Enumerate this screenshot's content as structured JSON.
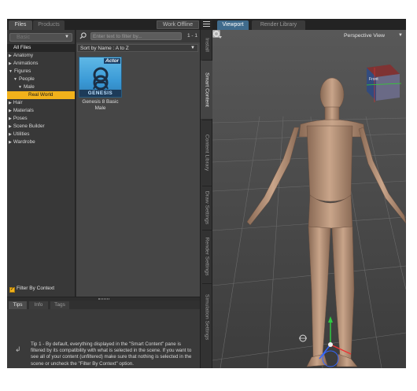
{
  "top_tabs": {
    "files": "Files",
    "products": "Products",
    "work_offline": "Work Offline"
  },
  "filter_dropdown": {
    "placeholder": "Basic"
  },
  "categories": [
    {
      "label": "All Files",
      "kind": "all"
    },
    {
      "label": "Anatomy",
      "kind": "collapsed"
    },
    {
      "label": "Animations",
      "kind": "collapsed"
    },
    {
      "label": "Figures",
      "kind": "expanded"
    },
    {
      "label": "People",
      "kind": "expanded-1"
    },
    {
      "label": "Male",
      "kind": "expanded-2"
    },
    {
      "label": "Real World",
      "kind": "selected"
    },
    {
      "label": "Hair",
      "kind": "collapsed"
    },
    {
      "label": "Materials",
      "kind": "collapsed"
    },
    {
      "label": "Poses",
      "kind": "collapsed"
    },
    {
      "label": "Scene Builder",
      "kind": "collapsed"
    },
    {
      "label": "Utilities",
      "kind": "collapsed"
    },
    {
      "label": "Wardrobe",
      "kind": "collapsed"
    }
  ],
  "filter_by_context": {
    "label": "Filter By Context",
    "checked": true
  },
  "search": {
    "placeholder": "Enter text to filter by...",
    "count": "1 - 1"
  },
  "sort": {
    "label": "Sort by Name : A to Z"
  },
  "asset": {
    "badge": "Actor",
    "band": "GENESIS",
    "name_line1": "Genesis 8 Basic",
    "name_line2": "Male"
  },
  "tips": {
    "tabs": [
      "Tips",
      "Info",
      "Tags"
    ],
    "text": "Tip 1 - By default, everything displayed in the \"Smart Content\" pane is filtered by its compatibility with what is selected in the scene. If you want to see all of your content (unfiltered) make sure that nothing is selected in the scene or uncheck the \"Filter By Context\" option."
  },
  "vertical_tabs": [
    "Install",
    "Smart Content",
    "Content Library",
    "Draw Settings",
    "Render Settings",
    "Simulation Settings"
  ],
  "viewport": {
    "tabs": [
      "Viewport",
      "Render Library"
    ],
    "camera_label": "Perspective View",
    "cube_face": "Front"
  },
  "colors": {
    "accent": "#f2b21b",
    "viewport_tab": "#3f6b8c",
    "panel": "#383838",
    "viewport_bg": "#4a4a4a"
  }
}
